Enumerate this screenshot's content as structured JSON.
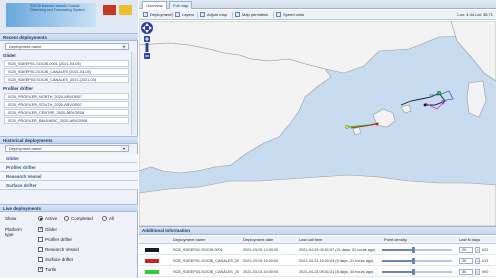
{
  "logo": {
    "text": "SOCIB Balearic Islands Coastal Observing and Forecasting System"
  },
  "left": {
    "recent_title": "Recent deployments",
    "recent_dropdown": "Deployment name",
    "glider_label": "Glider",
    "glider_items": [
      "SCB_SDEEP01-SOCIB-0001 (2021-03-03)",
      "SCB_SDEEP01-SOCIB_CANALES (2021-03-03)",
      "SCB_SDEEP03-SOCIB_CANALES_2021 (2021-03)"
    ],
    "profiler_label": "Profiler drifter",
    "profiler_items": [
      "SCB_PROFILER_NORTH_2020-ARVOR07",
      "SCB_PROFILER_SOUTH_2020-ARVOR07",
      "SCB_PROFILER_CENTRE_2020-ARVOR08",
      "SCB_PROFILER_BALEARIC_2020-ARVOR08"
    ],
    "historical_title": "Historical deployments",
    "historical_dropdown": "Deployment name",
    "categories": [
      "Glider",
      "Profiler drifter",
      "Research Vessel",
      "Surface drifter"
    ],
    "live_title": "Live deployments",
    "live_label": "Show",
    "radio_active": "Active",
    "radio_completed": "Completed",
    "radio_all": "All",
    "platform_label": "Platform type",
    "checks": [
      "Glider",
      "Profiler drifter",
      "Research Vessel",
      "Surface drifter",
      "Turtle"
    ]
  },
  "tabs": [
    "Overview",
    "Full map"
  ],
  "toolbar": {
    "deployments": "Deployments",
    "layers": "Layers",
    "adjust_map": "Adjust map",
    "map_permalink": "Map permalink",
    "speed_units": "Speed units",
    "coords": "Lon: 4.44 Lat: 38.71"
  },
  "bottom": {
    "title": "Additional information",
    "headers": [
      "Deployment name",
      "Deployment date",
      "Last call time",
      "Point density",
      "Last N days"
    ],
    "rows": [
      {
        "color": "#1a1a2e",
        "name": "SCB_SDEEP01-SOCIB-0001",
        "date": "2021-03-03 12:00:00",
        "last_call": "2021-04-23 09:51:57 (21 days, 02 hours ago)",
        "density": 0.45,
        "days": "20",
        "hrs": "h22"
      },
      {
        "color": "#cc2222",
        "name": "SCB_SDEEP01-SOCIB_CANALES_20...",
        "date": "2021-03-03 10:00:00",
        "last_call": "2021-04-23 10:00:03 (8 days, 21 hours ago)",
        "density": 0.45,
        "days": "20",
        "hrs": "h13"
      },
      {
        "color": "#33cc33",
        "name": "SCB_SDEEP03-SOCIB_CANALES_20...",
        "date": "2021-03-03 10:00:00",
        "last_call": "2021-04-23 09:51:31 (8 days, 04 hours ago)",
        "density": 0.45,
        "days": "30",
        "hrs": "h00"
      }
    ]
  }
}
